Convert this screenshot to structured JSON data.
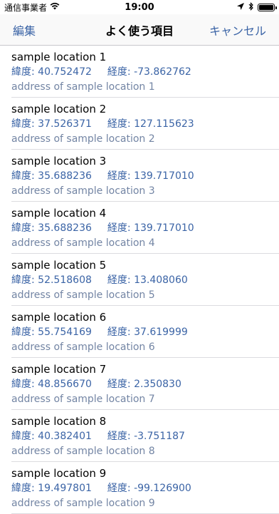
{
  "status": {
    "carrier": "通信事業者",
    "time": "19:00",
    "battery_level": 1.0
  },
  "nav": {
    "edit_label": "編集",
    "title": "よく使う項目",
    "cancel_label": "キャンセル"
  },
  "locations": [
    {
      "name": "sample location 1",
      "lat_label": "緯度:",
      "lat": "40.752472",
      "lon_label": "経度:",
      "lon": "-73.862762",
      "address": "address of sample location 1"
    },
    {
      "name": "sample location 2",
      "lat_label": "緯度:",
      "lat": "37.526371",
      "lon_label": "経度:",
      "lon": "127.115623",
      "address": "address of sample location 2"
    },
    {
      "name": "sample location 3",
      "lat_label": "緯度:",
      "lat": "35.688236",
      "lon_label": "経度:",
      "lon": "139.717010",
      "address": "address of sample location 3"
    },
    {
      "name": "sample location 4",
      "lat_label": "緯度:",
      "lat": "35.688236",
      "lon_label": "経度:",
      "lon": "139.717010",
      "address": "address of sample location 4"
    },
    {
      "name": "sample location 5",
      "lat_label": "緯度:",
      "lat": "52.518608",
      "lon_label": "経度:",
      "lon": "13.408060",
      "address": "address of sample location 5"
    },
    {
      "name": "sample location 6",
      "lat_label": "緯度:",
      "lat": "55.754169",
      "lon_label": "経度:",
      "lon": "37.619999",
      "address": "address of sample location 6"
    },
    {
      "name": "sample location 7",
      "lat_label": "緯度:",
      "lat": "48.856670",
      "lon_label": "経度:",
      "lon": "2.350830",
      "address": "address of sample location 7"
    },
    {
      "name": "sample location 8",
      "lat_label": "緯度:",
      "lat": "40.382401",
      "lon_label": "経度:",
      "lon": "-3.751187",
      "address": "address of sample location 8"
    },
    {
      "name": "sample location 9",
      "lat_label": "緯度:",
      "lat": "19.497801",
      "lon_label": "経度:",
      "lon": "-99.126900",
      "address": "address of sample location 9"
    }
  ]
}
